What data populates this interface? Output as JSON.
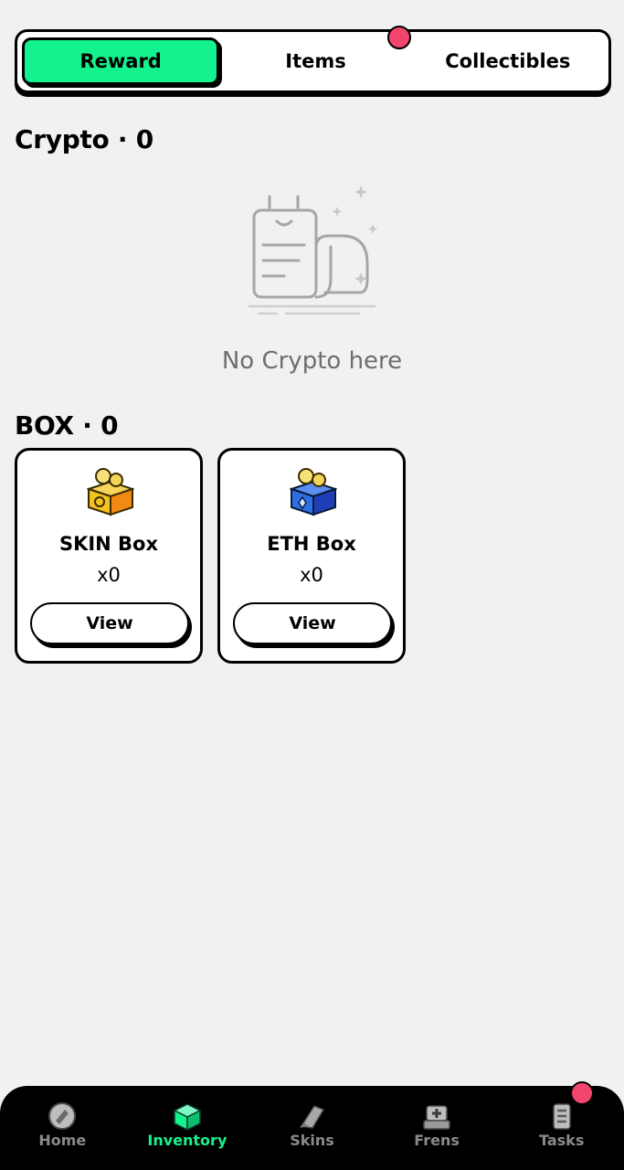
{
  "tabs": [
    {
      "label": "Reward",
      "active": true
    },
    {
      "label": "Items",
      "active": false
    },
    {
      "label": "Collectibles",
      "active": false
    }
  ],
  "crypto_section": {
    "title": "Crypto · 0",
    "empty_text": "No Crypto here"
  },
  "box_section": {
    "title": "BOX · 0",
    "boxes": [
      {
        "name": "SKIN Box",
        "count": "x0",
        "button": "View",
        "icon": "skin-box-icon"
      },
      {
        "name": "ETH Box",
        "count": "x0",
        "button": "View",
        "icon": "eth-box-icon"
      }
    ]
  },
  "nav": {
    "items": [
      {
        "label": "Home",
        "icon": "home-icon",
        "active": false
      },
      {
        "label": "Inventory",
        "icon": "inventory-icon",
        "active": true
      },
      {
        "label": "Skins",
        "icon": "skins-icon",
        "active": false
      },
      {
        "label": "Frens",
        "icon": "frens-icon",
        "active": false
      },
      {
        "label": "Tasks",
        "icon": "tasks-icon",
        "active": false
      }
    ]
  },
  "colors": {
    "accent": "#13f28c",
    "notification": "#f2456e",
    "background": "#f1f1f1",
    "nav_background": "#000000"
  }
}
